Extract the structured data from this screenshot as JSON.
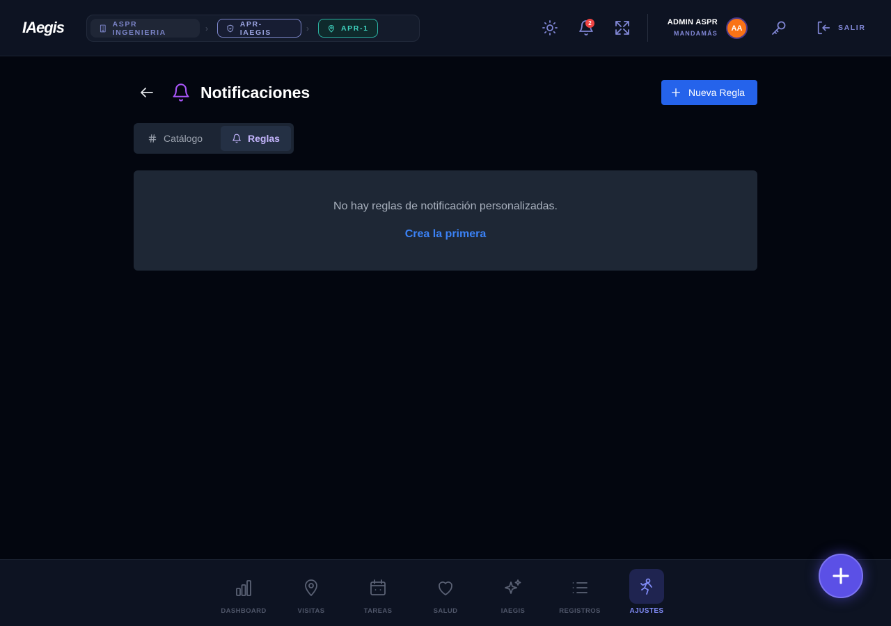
{
  "app": {
    "logo": "IAegis"
  },
  "breadcrumbs": [
    {
      "label": "ASPR INGENIERIA",
      "icon": "building-icon"
    },
    {
      "label": "APR-IAEGIS",
      "icon": "shield-icon"
    },
    {
      "label": "APR-1",
      "icon": "map-pin-icon"
    }
  ],
  "header": {
    "notifications_count": "2",
    "user_name": "ADMIN ASPR",
    "user_role": "MANDAMÁS",
    "avatar_initials": "AA",
    "logout_label": "SALIR"
  },
  "page": {
    "title": "Notificaciones",
    "new_rule_label": "Nueva Regla"
  },
  "tabs": [
    {
      "label": "Catálogo",
      "icon": "hash-icon",
      "active": false
    },
    {
      "label": "Reglas",
      "icon": "bell-icon",
      "active": true
    }
  ],
  "empty_state": {
    "message": "No hay reglas de notificación personalizadas.",
    "link": "Crea la primera"
  },
  "bottom_nav": [
    {
      "label": "DASHBOARD",
      "icon": "bar-chart-icon"
    },
    {
      "label": "VISITAS",
      "icon": "map-pin-icon"
    },
    {
      "label": "TAREAS",
      "icon": "calendar-icon"
    },
    {
      "label": "SALUD",
      "icon": "heart-icon"
    },
    {
      "label": "IAEGIS",
      "icon": "sparkles-icon"
    },
    {
      "label": "REGISTROS",
      "icon": "list-icon"
    },
    {
      "label": "AJUSTES",
      "icon": "settings-icon",
      "active": true
    }
  ],
  "colors": {
    "background": "#03060f",
    "topbar": "#0d1322",
    "accent_blue": "#2563eb",
    "accent_violet": "#a855f7",
    "accent_indigo": "#818cf8",
    "badge_red": "#ef4444",
    "avatar_orange": "#f97316"
  }
}
